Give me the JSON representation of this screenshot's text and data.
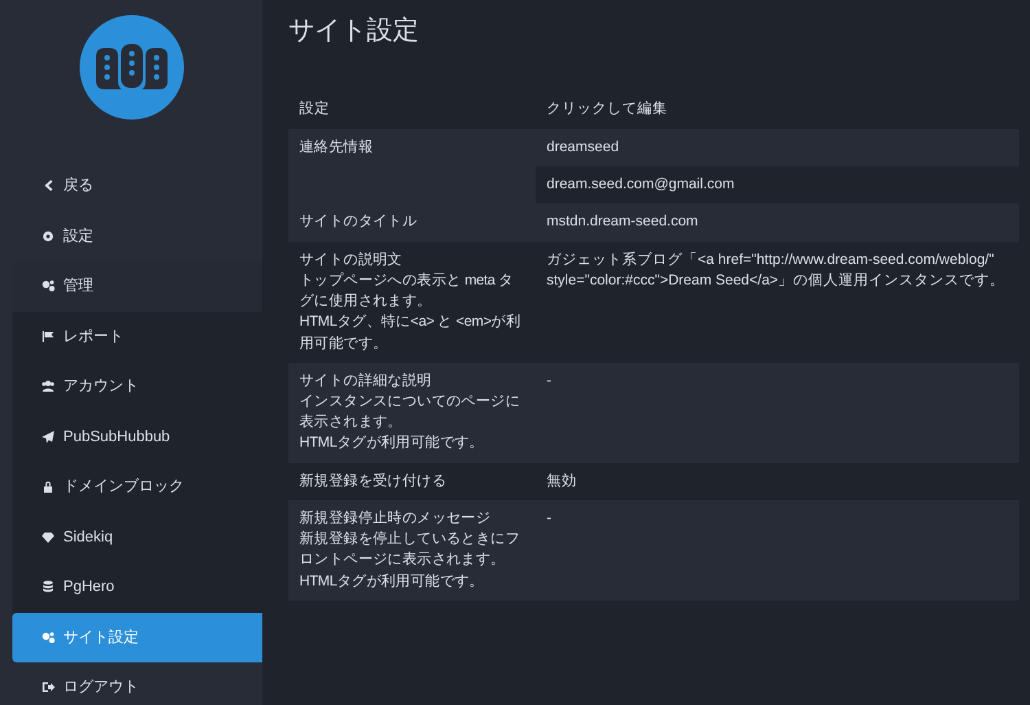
{
  "sidebar": {
    "items": [
      {
        "label": "戻る",
        "selected": false
      },
      {
        "label": "設定",
        "selected": false
      },
      {
        "label": "管理",
        "selected": false,
        "children": [
          {
            "label": "レポート",
            "selected": false
          },
          {
            "label": "アカウント",
            "selected": false
          },
          {
            "label": "PubSubHubbub",
            "selected": false
          },
          {
            "label": "ドメインブロック",
            "selected": false
          },
          {
            "label": "Sidekiq",
            "selected": false
          },
          {
            "label": "PgHero",
            "selected": false
          },
          {
            "label": "サイト設定",
            "selected": true
          }
        ]
      },
      {
        "label": "ログアウト",
        "selected": false
      }
    ]
  },
  "page_title": "サイト設定",
  "table": {
    "columns": [
      "設定",
      "クリックして編集"
    ],
    "rows": [
      {
        "label": "連絡先情報",
        "values": [
          "dreamseed",
          "dream.seed.com@gmail.com"
        ]
      },
      {
        "label": "サイトのタイトル",
        "values": [
          "mstdn.dream-seed.com"
        ]
      },
      {
        "label": "サイトの説明文",
        "hint": "トップページへの表示と meta タグに使用されます。\nHTMLタグ、特に<a> と <em>が利用可能です。",
        "values": [
          "ガジェット系ブログ「<a href=\"http://www.dream-seed.com/weblog/\" style=\"color:#ccc\">Dream Seed</a>」の個人運用インスタンスです。"
        ]
      },
      {
        "label": "サイトの詳細な説明",
        "hint": "インスタンスについてのページに表示されます。\nHTMLタグが利用可能です。",
        "values": [
          "-"
        ]
      },
      {
        "label": "新規登録を受け付ける",
        "values": [
          "無効"
        ]
      },
      {
        "label": "新規登録停止時のメッセージ",
        "hint": "新規登録を停止しているときにフロントページに表示されます。\nHTMLタグが利用可能です。",
        "values": [
          "-"
        ]
      }
    ]
  }
}
